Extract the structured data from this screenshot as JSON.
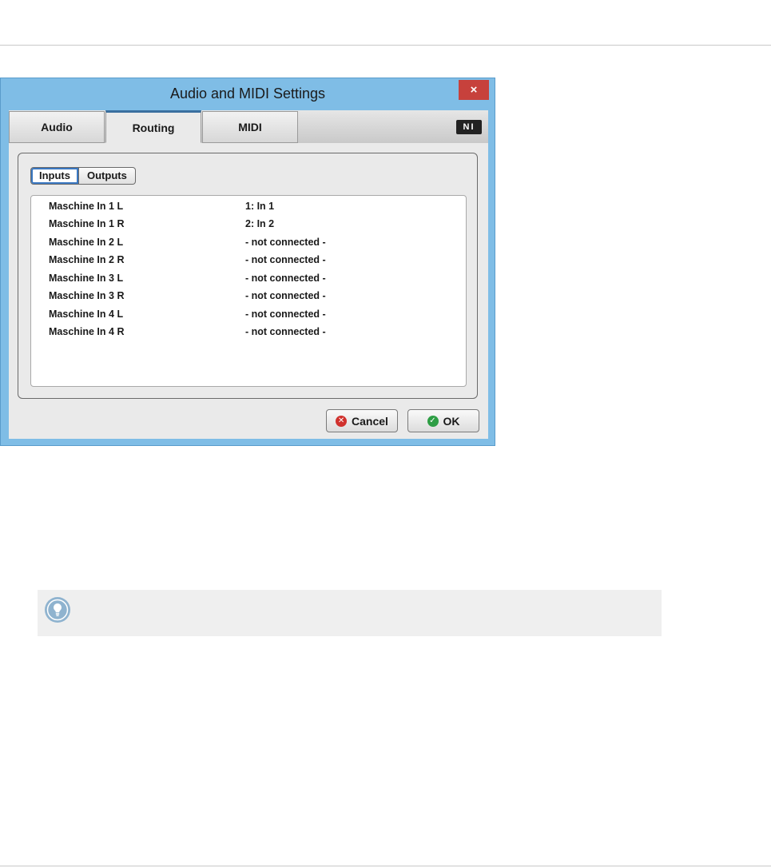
{
  "window": {
    "title": "Audio and MIDI Settings",
    "close_label": "×"
  },
  "tabs": [
    {
      "label": "Audio"
    },
    {
      "label": "Routing"
    },
    {
      "label": "MIDI"
    }
  ],
  "logo_text": "NI",
  "segments": {
    "inputs_label": "Inputs",
    "outputs_label": "Outputs",
    "selected": "Inputs"
  },
  "routing_rows": [
    {
      "channel": "Maschine In 1 L",
      "source": "1: In 1"
    },
    {
      "channel": "Maschine In 1 R",
      "source": "2: In 2"
    },
    {
      "channel": "Maschine In 2 L",
      "source": "- not connected -"
    },
    {
      "channel": "Maschine In 2 R",
      "source": "- not connected -"
    },
    {
      "channel": "Maschine In 3 L",
      "source": "- not connected -"
    },
    {
      "channel": "Maschine In 3 R",
      "source": "- not connected -"
    },
    {
      "channel": "Maschine In 4 L",
      "source": "- not connected -"
    },
    {
      "channel": "Maschine In 4 R",
      "source": "- not connected -"
    }
  ],
  "buttons": {
    "cancel_label": "Cancel",
    "ok_label": "OK"
  },
  "colors": {
    "window_frame": "#7fbde6",
    "close_button": "#c7413c",
    "active_tab_accent": "#3a6f9f",
    "cancel_icon": "#d0312d",
    "ok_icon": "#2e9e45",
    "tip_icon": "#8fb3cf"
  },
  "tip": {
    "icon": "lightbulb-icon"
  }
}
